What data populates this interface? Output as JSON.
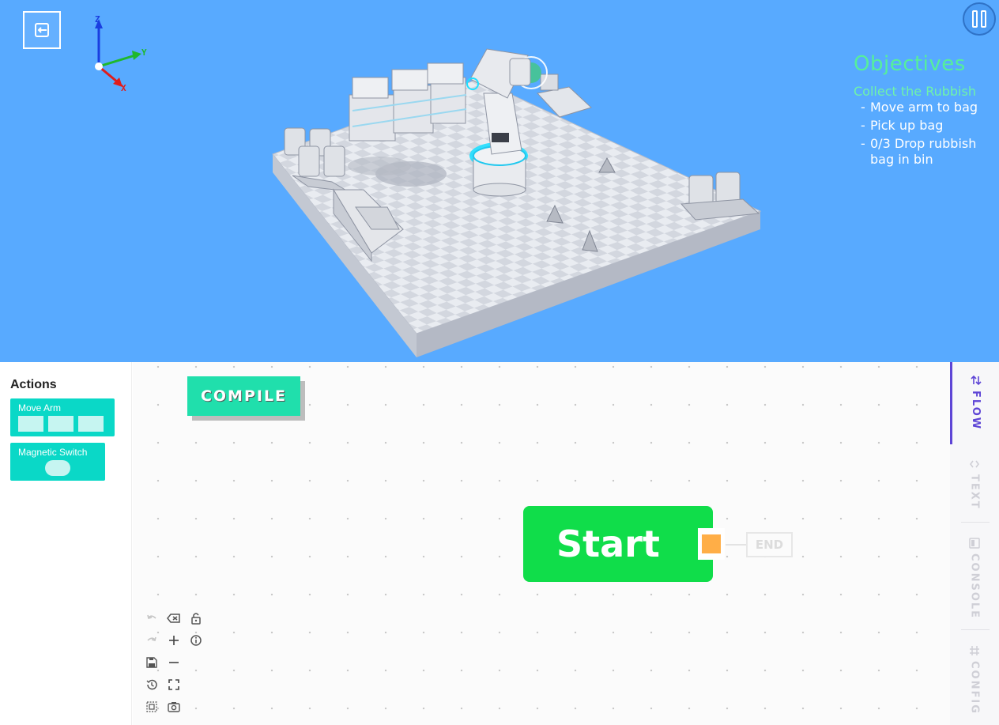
{
  "viewport": {
    "exit_icon": "exit-icon",
    "pause_icon": "pause-icon",
    "axes": {
      "z": "Z",
      "y": "Y",
      "x": "X"
    },
    "colors": {
      "sky": "#58aaff",
      "floor": "#c8ccd6",
      "accent": "#20dfff"
    }
  },
  "objectives": {
    "title": "Objectives",
    "subtitle": "Collect the Rubbish",
    "steps": [
      {
        "dash": "-",
        "text": "Move arm to bag"
      },
      {
        "dash": "-",
        "text": "Pick up bag"
      },
      {
        "dash": "-",
        "text": "0/3 Drop rubbish bag in bin"
      }
    ]
  },
  "actions": {
    "title": "Actions",
    "items": [
      {
        "label": "Move Arm"
      },
      {
        "label": "Magnetic Switch"
      }
    ]
  },
  "canvas": {
    "compile_label": "COMPILE",
    "start_label": "Start",
    "end_label": "END"
  },
  "toolbar": {
    "icons": [
      "undo-icon",
      "clear-icon",
      "lock-icon",
      "redo-icon",
      "zoom-in-icon",
      "info-icon",
      "save-icon",
      "zoom-out-icon",
      "history-icon",
      "fullscreen-icon",
      "select-icon",
      "screenshot-icon"
    ]
  },
  "side_tabs": [
    {
      "label": "FLOW",
      "active": true
    },
    {
      "label": "TEXT",
      "active": false
    },
    {
      "label": "CONSOLE",
      "active": false
    },
    {
      "label": "CONFIG",
      "active": false
    }
  ]
}
